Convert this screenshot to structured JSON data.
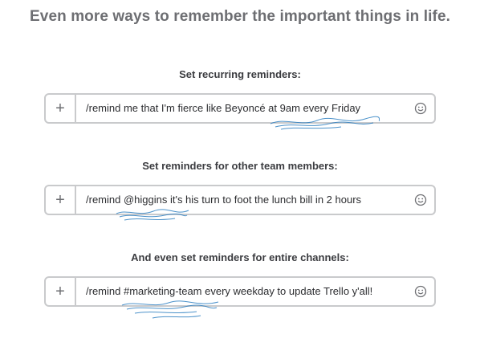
{
  "headline": "Even more ways to remember the important things in life.",
  "sections": [
    {
      "label": "Set recurring reminders:",
      "command": "/remind me that I'm fierce like Beyoncé at 9am every Friday",
      "plus_icon": "plus-icon",
      "emoji_icon": "emoji-smiley-icon"
    },
    {
      "label": "Set reminders for other team members:",
      "command": "/remind @higgins it's his turn to foot the lunch bill in 2 hours",
      "plus_icon": "plus-icon",
      "emoji_icon": "emoji-smiley-icon"
    },
    {
      "label": "And even set reminders for entire channels:",
      "command": "/remind #marketing-team every weekday to update Trello y'all!",
      "plus_icon": "plus-icon",
      "emoji_icon": "emoji-smiley-icon"
    }
  ],
  "colors": {
    "headline": "#6d6e72",
    "border": "#c9cacc",
    "scribble": "#2d7fc1"
  }
}
